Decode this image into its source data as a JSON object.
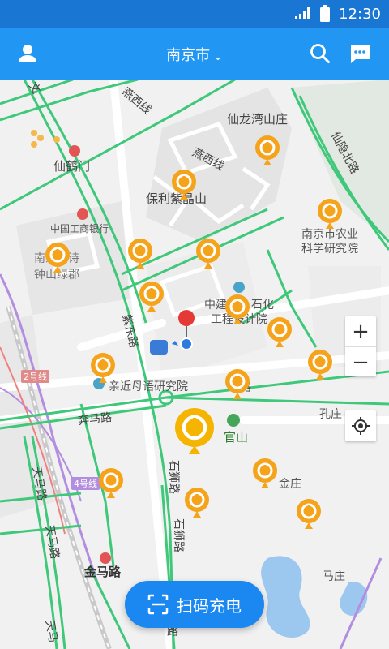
{
  "status_bar": {
    "time": "12:30"
  },
  "header": {
    "city": "南京市",
    "city_chevron": "⌄"
  },
  "map": {
    "place_labels": {
      "xianhemen": "仙鹤门",
      "icbc": "中国工商银行",
      "xianlongwan": "仙龙湾山庄",
      "baoli": "保利紫晶山",
      "nongke": "南京市农业",
      "nongke2": "科学研究院",
      "langshi": "南京朗诗",
      "zhongshanlvjun": "钟山绿郡",
      "zhongjian": "中建",
      "shihua": "石化",
      "gongcheng": "工程设计院",
      "qinjin": "亲近母语研究院",
      "guanshan": "官山",
      "kongzhuang": "孔庄",
      "jinzhuang": "金庄",
      "mazhuang": "马庄",
      "jinmalu": "金马路"
    },
    "road_labels": {
      "yanxi1": "燕西线",
      "yanxi2": "燕西线",
      "xianyin": "仙隐北路",
      "zidong": "紫东路",
      "benma": "奔马路",
      "tianma1": "天马路",
      "tianma2": "天马路",
      "tianma3": "天马",
      "shishi1": "石狮路",
      "shishi2": "石狮路",
      "shishi3": "路",
      "road_mid": "路",
      "line2": "2号线",
      "line4": "4号线",
      "wen": "文"
    },
    "zoom_in": "+",
    "zoom_out": "−"
  },
  "scan_button": {
    "label": "扫码充电"
  },
  "colors": {
    "appbar": "#2196f3",
    "statusbar": "#1976d2",
    "road_green": "#3fc87a",
    "marker": "#f5a31a",
    "scan_button": "#1b88f2",
    "pin": "#e53935"
  },
  "icons": [
    "user-icon",
    "search-icon",
    "message-icon",
    "charging-station-icon",
    "zoom-in-icon",
    "zoom-out-icon",
    "locate-icon",
    "scan-icon",
    "signal-icon",
    "battery-icon"
  ]
}
